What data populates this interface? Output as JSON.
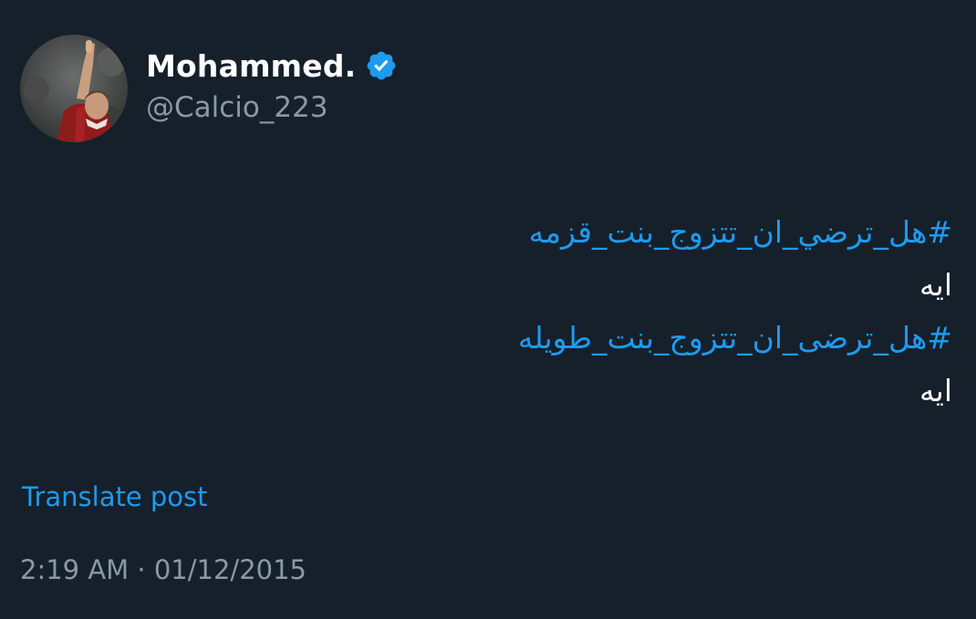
{
  "author": {
    "display_name": "Mohammed.",
    "handle": "@Calcio_223",
    "verified": true,
    "verified_icon": "verified-badge-icon",
    "avatar": "avatar-photo"
  },
  "post": {
    "lines": [
      {
        "type": "hashtag",
        "text": "#هل_ترضي_ان_تتزوج_بنت_قزمه"
      },
      {
        "type": "text",
        "text": "ايه"
      },
      {
        "type": "hashtag",
        "text": "#هل_ترضى_ان_تتزوج_بنت_طويله"
      },
      {
        "type": "text",
        "text": "ايه"
      }
    ]
  },
  "translate_label": "Translate post",
  "timestamp": "2:19 AM · 01/12/2015",
  "colors": {
    "background": "#15202b",
    "accent": "#1d9bf0",
    "secondary_text": "#8b98a5",
    "primary_text": "#ffffff"
  }
}
